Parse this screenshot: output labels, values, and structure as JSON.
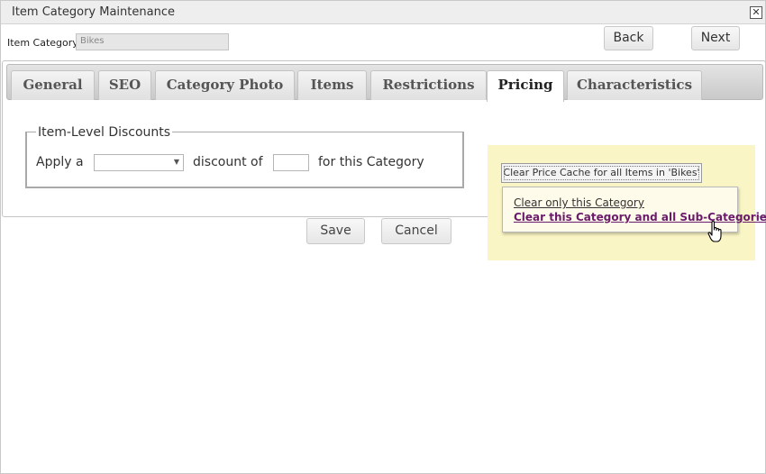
{
  "window": {
    "title": "Item Category Maintenance",
    "close_glyph": "✕"
  },
  "header": {
    "category_label": "Item Category:",
    "category_value": "Bikes",
    "back_label": "Back",
    "next_label": "Next"
  },
  "tabs": [
    {
      "label": "General",
      "active": false
    },
    {
      "label": "SEO",
      "active": false
    },
    {
      "label": "Category Photo",
      "active": false
    },
    {
      "label": "Items",
      "active": false
    },
    {
      "label": "Restrictions",
      "active": false
    },
    {
      "label": "Pricing",
      "active": true
    },
    {
      "label": "Characteristics",
      "active": false
    }
  ],
  "pricing": {
    "legend": "Item-Level Discounts",
    "apply_a": "Apply a",
    "discount_select_value": "",
    "discount_of": "discount of",
    "discount_value": "",
    "for_category": "for this Category"
  },
  "actions": {
    "save_label": "Save",
    "cancel_label": "Cancel"
  },
  "cache": {
    "button_label": "Clear Price Cache for all Items in 'Bikes'",
    "options": [
      "Clear only this Category",
      "Clear this Category and all Sub-Categories"
    ]
  },
  "colors": {
    "cache_panel_bg": "#faf5c4",
    "visited_link": "#6a1b6a"
  },
  "icons": {
    "close": "close-icon",
    "dropdown": "chevron-down-icon",
    "cursor": "hand-pointer-icon"
  }
}
